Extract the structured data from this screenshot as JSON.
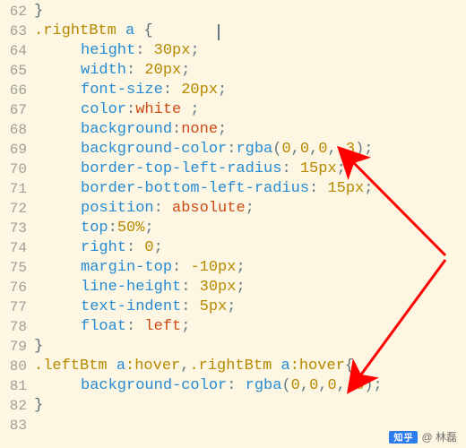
{
  "watermark": {
    "platform": "知乎",
    "author": "@ 林磊"
  },
  "code_lines": [
    {
      "n": 62,
      "tokens": [
        {
          "t": "}",
          "c": "brace"
        }
      ]
    },
    {
      "n": 63,
      "tokens": [
        {
          "t": ".rightBtm",
          "c": "sel"
        },
        {
          "t": " ",
          "c": "punct"
        },
        {
          "t": "a",
          "c": "hex1"
        },
        {
          "t": " ",
          "c": "punct"
        },
        {
          "t": "{",
          "c": "brace"
        }
      ]
    },
    {
      "n": 64,
      "indent": true,
      "tokens": [
        {
          "t": "height",
          "c": "prop"
        },
        {
          "t": ": ",
          "c": "punct"
        },
        {
          "t": "30px",
          "c": "num"
        },
        {
          "t": ";",
          "c": "punct"
        }
      ]
    },
    {
      "n": 65,
      "indent": true,
      "tokens": [
        {
          "t": "width",
          "c": "prop"
        },
        {
          "t": ": ",
          "c": "punct"
        },
        {
          "t": "20px",
          "c": "num"
        },
        {
          "t": ";",
          "c": "punct"
        }
      ]
    },
    {
      "n": 66,
      "indent": true,
      "tokens": [
        {
          "t": "font-size",
          "c": "prop"
        },
        {
          "t": ": ",
          "c": "punct"
        },
        {
          "t": "20px",
          "c": "num"
        },
        {
          "t": ";",
          "c": "punct"
        }
      ]
    },
    {
      "n": 67,
      "indent": true,
      "tokens": [
        {
          "t": "color",
          "c": "prop"
        },
        {
          "t": ":",
          "c": "punct"
        },
        {
          "t": "white",
          "c": "kw"
        },
        {
          "t": " ;",
          "c": "punct"
        }
      ]
    },
    {
      "n": 68,
      "indent": true,
      "tokens": [
        {
          "t": "background",
          "c": "prop"
        },
        {
          "t": ":",
          "c": "punct"
        },
        {
          "t": "none",
          "c": "kw"
        },
        {
          "t": ";",
          "c": "punct"
        }
      ]
    },
    {
      "n": 69,
      "indent": true,
      "tokens": [
        {
          "t": "background-color",
          "c": "prop"
        },
        {
          "t": ":",
          "c": "punct"
        },
        {
          "t": "rgba",
          "c": "fn"
        },
        {
          "t": "(",
          "c": "punct"
        },
        {
          "t": "0",
          "c": "num"
        },
        {
          "t": ",",
          "c": "punct"
        },
        {
          "t": "0",
          "c": "num"
        },
        {
          "t": ",",
          "c": "punct"
        },
        {
          "t": "0",
          "c": "num"
        },
        {
          "t": ",",
          "c": "punct"
        },
        {
          "t": ".3",
          "c": "num"
        },
        {
          "t": ");",
          "c": "punct"
        }
      ]
    },
    {
      "n": 70,
      "indent": true,
      "tokens": [
        {
          "t": "border-top-left-radius",
          "c": "prop"
        },
        {
          "t": ": ",
          "c": "punct"
        },
        {
          "t": "15px",
          "c": "num"
        },
        {
          "t": ";",
          "c": "punct"
        }
      ]
    },
    {
      "n": 71,
      "indent": true,
      "tokens": [
        {
          "t": "border-bottom-left-radius",
          "c": "prop"
        },
        {
          "t": ": ",
          "c": "punct"
        },
        {
          "t": "15px",
          "c": "num"
        },
        {
          "t": ";",
          "c": "punct"
        }
      ]
    },
    {
      "n": 72,
      "indent": true,
      "tokens": [
        {
          "t": "position",
          "c": "prop"
        },
        {
          "t": ": ",
          "c": "punct"
        },
        {
          "t": "absolute",
          "c": "kw"
        },
        {
          "t": ";",
          "c": "punct"
        }
      ]
    },
    {
      "n": 73,
      "indent": true,
      "tokens": [
        {
          "t": "top",
          "c": "prop"
        },
        {
          "t": ":",
          "c": "punct"
        },
        {
          "t": "50%",
          "c": "num"
        },
        {
          "t": ";",
          "c": "punct"
        }
      ]
    },
    {
      "n": 74,
      "indent": true,
      "tokens": [
        {
          "t": "right",
          "c": "prop"
        },
        {
          "t": ": ",
          "c": "punct"
        },
        {
          "t": "0",
          "c": "num"
        },
        {
          "t": ";",
          "c": "punct"
        }
      ]
    },
    {
      "n": 75,
      "indent": true,
      "tokens": [
        {
          "t": "margin-top",
          "c": "prop"
        },
        {
          "t": ": ",
          "c": "punct"
        },
        {
          "t": "-10px",
          "c": "num"
        },
        {
          "t": ";",
          "c": "punct"
        }
      ]
    },
    {
      "n": 76,
      "indent": true,
      "tokens": [
        {
          "t": "line-height",
          "c": "prop"
        },
        {
          "t": ": ",
          "c": "punct"
        },
        {
          "t": "30px",
          "c": "num"
        },
        {
          "t": ";",
          "c": "punct"
        }
      ]
    },
    {
      "n": 77,
      "indent": true,
      "tokens": [
        {
          "t": "text-indent",
          "c": "prop"
        },
        {
          "t": ": ",
          "c": "punct"
        },
        {
          "t": "5px",
          "c": "num"
        },
        {
          "t": ";",
          "c": "punct"
        }
      ]
    },
    {
      "n": 78,
      "indent": true,
      "tokens": [
        {
          "t": "float",
          "c": "prop"
        },
        {
          "t": ": ",
          "c": "punct"
        },
        {
          "t": "left",
          "c": "kw"
        },
        {
          "t": ";",
          "c": "punct"
        }
      ]
    },
    {
      "n": 79,
      "tokens": [
        {
          "t": "}",
          "c": "brace"
        }
      ]
    },
    {
      "n": 80,
      "tokens": [
        {
          "t": ".leftBtm",
          "c": "sel"
        },
        {
          "t": " ",
          "c": "punct"
        },
        {
          "t": "a",
          "c": "hex1"
        },
        {
          "t": ":hover",
          "c": "sel"
        },
        {
          "t": ",",
          "c": "punct"
        },
        {
          "t": ".rightBtm",
          "c": "sel"
        },
        {
          "t": " ",
          "c": "punct"
        },
        {
          "t": "a",
          "c": "hex1"
        },
        {
          "t": ":hover",
          "c": "sel"
        },
        {
          "t": "{",
          "c": "brace"
        }
      ]
    },
    {
      "n": 81,
      "indent": true,
      "tokens": [
        {
          "t": "background-color",
          "c": "prop"
        },
        {
          "t": ": ",
          "c": "punct"
        },
        {
          "t": "rgba",
          "c": "fn"
        },
        {
          "t": "(",
          "c": "punct"
        },
        {
          "t": "0",
          "c": "num"
        },
        {
          "t": ",",
          "c": "punct"
        },
        {
          "t": "0",
          "c": "num"
        },
        {
          "t": ",",
          "c": "punct"
        },
        {
          "t": "0",
          "c": "num"
        },
        {
          "t": ",",
          "c": "punct"
        },
        {
          "t": ".6",
          "c": "num"
        },
        {
          "t": ");",
          "c": "punct"
        }
      ]
    },
    {
      "n": 82,
      "tokens": [
        {
          "t": "}",
          "c": "brace"
        }
      ]
    },
    {
      "n": 83,
      "tokens": []
    }
  ]
}
